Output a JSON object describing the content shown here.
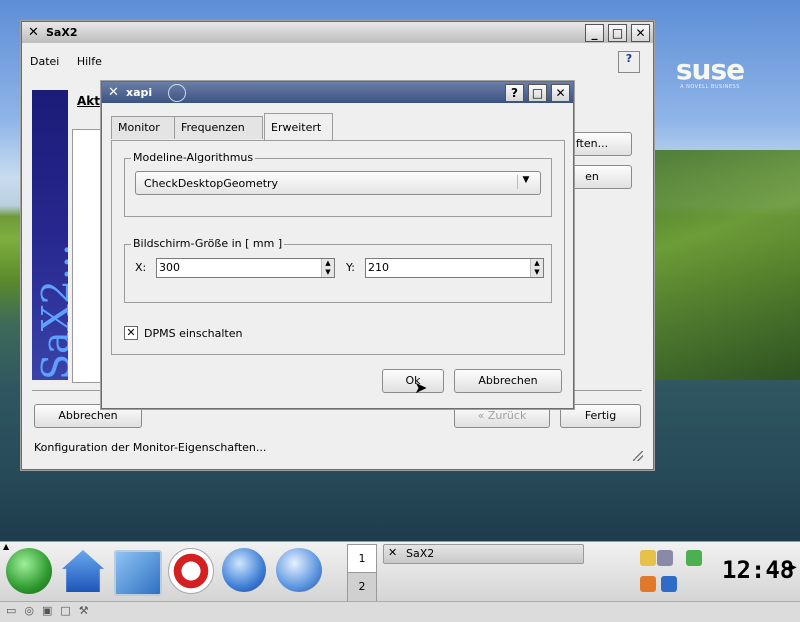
{
  "sax2_window": {
    "title": "SaX2",
    "menu": {
      "file": "Datei",
      "help": "Hilfe"
    },
    "sidebar_brand": "SaX2...",
    "heading_partial": "Akt",
    "btn_right_1": "ften...",
    "btn_right_2": "en",
    "cancel": "Abbrechen",
    "back": "« Zurück",
    "finish": "Fertig",
    "status": "Konfiguration der Monitor-Eigenschaften..."
  },
  "dialog": {
    "title": "xapi",
    "tabs": [
      {
        "label": "Monitor"
      },
      {
        "label": "Frequenzen"
      },
      {
        "label": "Erweitert"
      }
    ],
    "active_tab": "Erweitert",
    "modeline_group": "Modeline-Algorithmus",
    "modeline_value": "CheckDesktopGeometry",
    "screen_group": "Bildschirm-Größe in [ mm ]",
    "x_label": "X:",
    "x_value": "300",
    "y_label": "Y:",
    "y_value": "210",
    "dpms_label": "DPMS einschalten",
    "dpms_checked": true,
    "ok": "Ok",
    "cancel": "Abbrechen"
  },
  "desktop": {
    "brand": "suse",
    "brand_sub": "A NOVELL BUSINESS"
  },
  "taskbar": {
    "launchers": [
      "suse-menu-icon",
      "home-folder-icon",
      "desktop-preferences-icon",
      "help-lifebuoy-icon",
      "konqueror-globe-icon",
      "mail-calendar-icon"
    ],
    "desktops": [
      "1",
      "2"
    ],
    "active_desktop": "1",
    "task": "SaX2",
    "clock": "12:48"
  },
  "colors": {
    "title_active": "#3c5282",
    "accent_green": "#3aa83a"
  }
}
